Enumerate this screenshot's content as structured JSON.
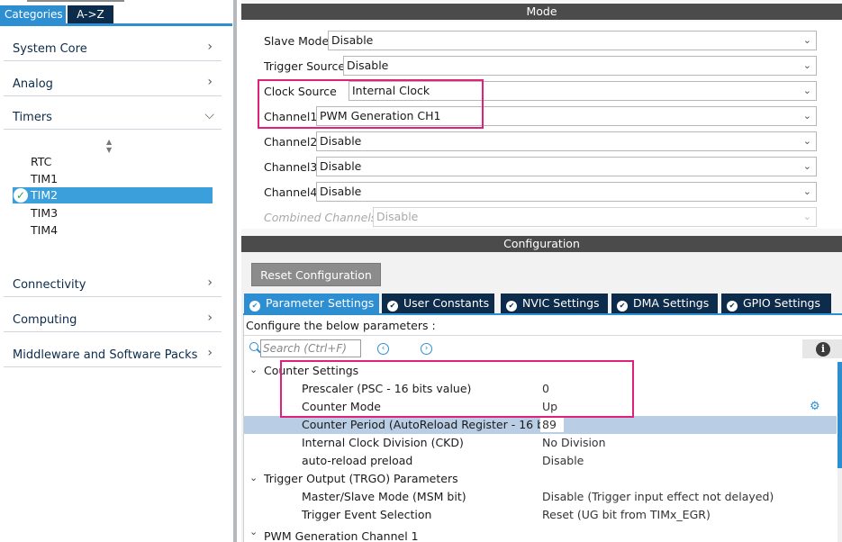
{
  "left_tabs": {
    "categories": "Categories",
    "az": "A->Z"
  },
  "categories": [
    {
      "label": "System Core",
      "chevron": ">"
    },
    {
      "label": "Analog",
      "chevron": ">"
    },
    {
      "label": "Timers",
      "chevron": "v"
    },
    {
      "label": "Connectivity",
      "chevron": ">"
    },
    {
      "label": "Computing",
      "chevron": ">"
    },
    {
      "label": "Middleware and Software Packs",
      "chevron": ">"
    }
  ],
  "timers": {
    "items": [
      "RTC",
      "TIM1",
      "TIM2",
      "TIM3",
      "TIM4"
    ],
    "selected": "TIM2"
  },
  "mode": {
    "header": "Mode",
    "rows": [
      {
        "label": "Slave Mode",
        "value": "Disable"
      },
      {
        "label": "Trigger Source",
        "value": "Disable"
      },
      {
        "label": "Clock Source",
        "value": "Internal Clock"
      },
      {
        "label": "Channel1",
        "value": "PWM Generation CH1"
      },
      {
        "label": "Channel2",
        "value": "Disable"
      },
      {
        "label": "Channel3",
        "value": "Disable"
      },
      {
        "label": "Channel4",
        "value": "Disable"
      },
      {
        "label": "Combined Channels",
        "value": "Disable"
      }
    ]
  },
  "configuration": {
    "header": "Configuration",
    "reset_label": "Reset Configuration",
    "tabs": [
      "Parameter Settings",
      "User Constants",
      "NVIC Settings",
      "DMA Settings",
      "GPIO Settings"
    ],
    "active_tab": "Parameter Settings",
    "hint": "Configure the below parameters :",
    "search_placeholder": "Search (Ctrl+F)"
  },
  "params": {
    "counter_group": "Counter Settings",
    "prescaler": {
      "name": "Prescaler (PSC - 16 bits value)",
      "value": "0"
    },
    "counter_mode": {
      "name": "Counter Mode",
      "value": "Up"
    },
    "counter_period": {
      "name": "Counter Period (AutoReload Register - 16 b...",
      "value": "89"
    },
    "ckd": {
      "name": "Internal Clock Division (CKD)",
      "value": "No Division"
    },
    "preload": {
      "name": "auto-reload preload",
      "value": "Disable"
    },
    "trgo_group": "Trigger Output (TRGO) Parameters",
    "msm": {
      "name": "Master/Slave Mode (MSM bit)",
      "value": "Disable (Trigger input effect not delayed)"
    },
    "trigger_event": {
      "name": "Trigger Event Selection",
      "value": "Reset (UG bit from TIMx_EGR)"
    },
    "pwm_group": "PWM Generation Channel 1"
  },
  "colors": {
    "accent": "#2d8fd2",
    "navy": "#0d2b4a",
    "highlight": "#e0217a",
    "header_bar": "#4b4b4b"
  }
}
